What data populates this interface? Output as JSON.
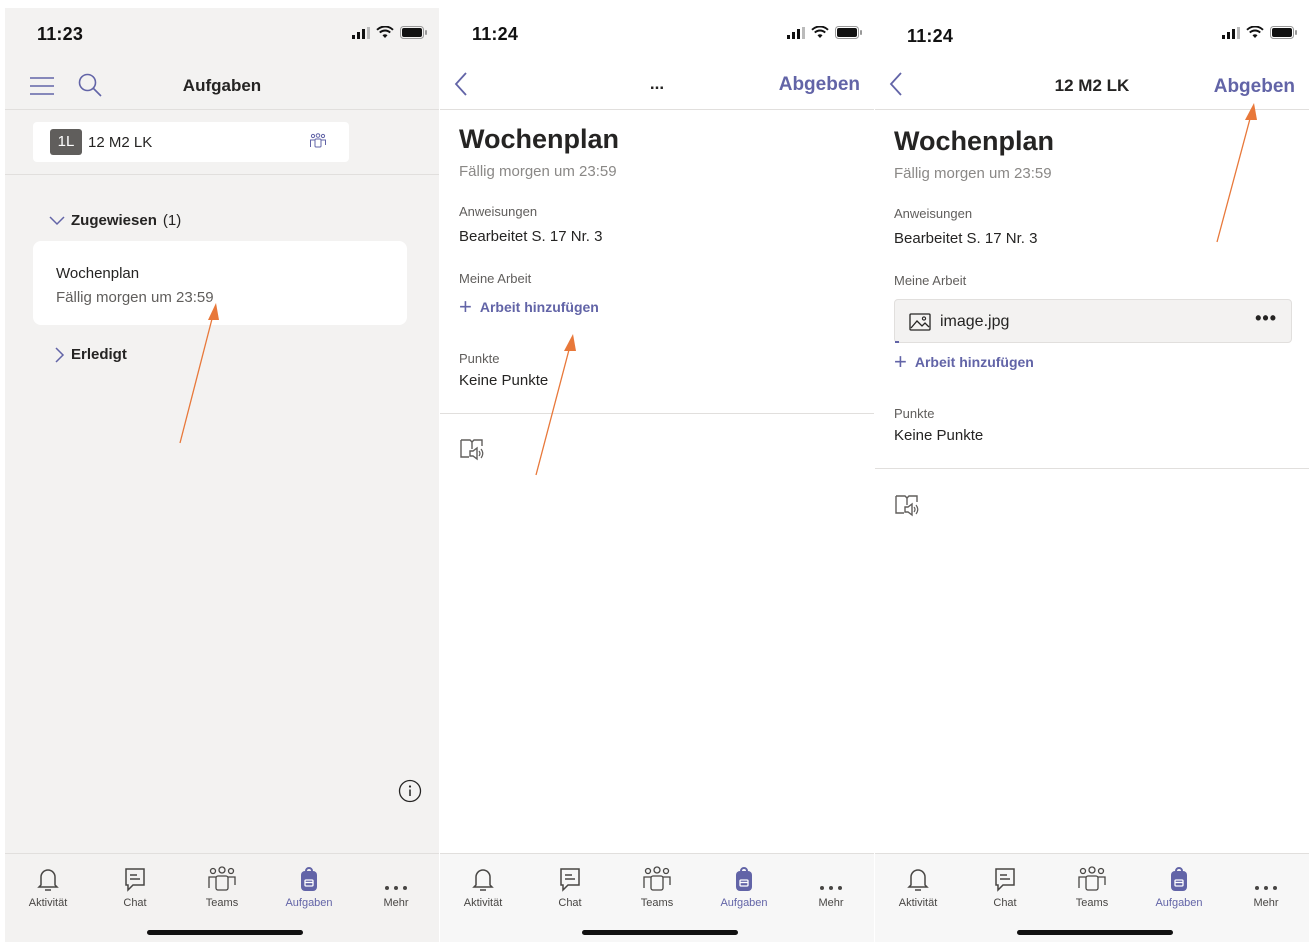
{
  "accent_color": "#6264a7",
  "annotation_color": "#e8783a",
  "panels": [
    {
      "status_time": "11:23",
      "nav": {
        "title": "Aufgaben",
        "menu_icon": "hamburger-icon",
        "search_icon": "search-icon"
      },
      "class_picker": {
        "badge": "1L",
        "name": "12 M2 LK",
        "icon": "team-icon"
      },
      "assigned": {
        "label": "Zugewiesen",
        "count": "(1)"
      },
      "task": {
        "title": "Wochenplan",
        "due": "Fällig morgen um 23:59"
      },
      "done": {
        "label": "Erledigt"
      }
    },
    {
      "status_time": "11:24",
      "nav": {
        "dots": "...",
        "submit": "Abgeben"
      },
      "title": "Wochenplan",
      "due": "Fällig morgen um 23:59",
      "instructions_label": "Anweisungen",
      "instructions": "Bearbeitet S. 17 Nr. 3",
      "my_work_label": "Meine Arbeit",
      "add_work": "Arbeit hinzufügen",
      "points_label": "Punkte",
      "points": "Keine Punkte"
    },
    {
      "status_time": "11:24",
      "nav": {
        "title": "12 M2 LK",
        "submit": "Abgeben"
      },
      "title": "Wochenplan",
      "due": "Fällig morgen um 23:59",
      "instructions_label": "Anweisungen",
      "instructions": "Bearbeitet S. 17 Nr. 3",
      "my_work_label": "Meine Arbeit",
      "file": {
        "name": "image.jpg",
        "more": "•••"
      },
      "add_work": "Arbeit hinzufügen",
      "points_label": "Punkte",
      "points": "Keine Punkte"
    }
  ],
  "tabs": [
    {
      "label": "Aktivität",
      "icon": "bell-icon"
    },
    {
      "label": "Chat",
      "icon": "chat-icon"
    },
    {
      "label": "Teams",
      "icon": "teams-icon"
    },
    {
      "label": "Aufgaben",
      "icon": "backpack-icon",
      "active": true
    },
    {
      "label": "Mehr",
      "icon": "more-icon"
    }
  ]
}
